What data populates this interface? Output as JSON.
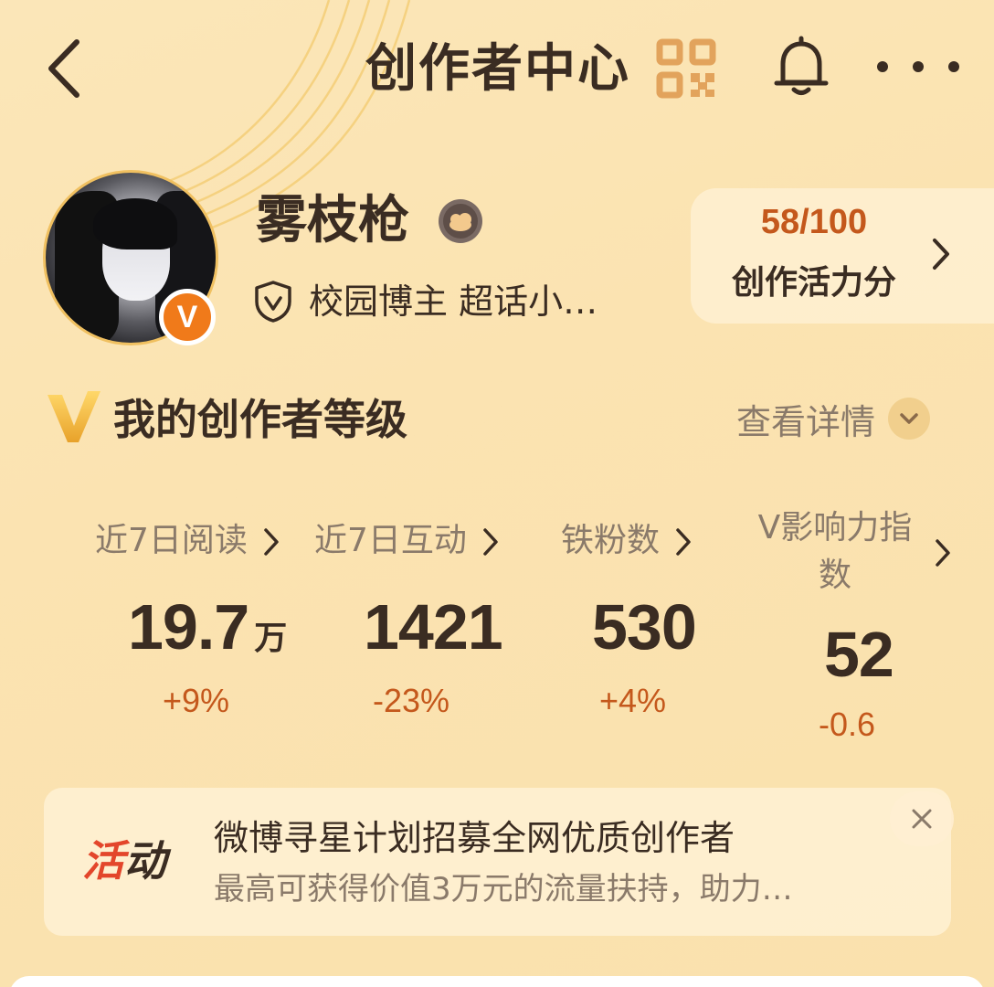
{
  "header": {
    "title": "创作者中心"
  },
  "profile": {
    "username": "雾枝枪",
    "tags": "校园博主 超话小…",
    "verified_badge": "V"
  },
  "score": {
    "value": "58/100",
    "label": "创作活力分"
  },
  "level_section": {
    "title": "我的创作者等级",
    "detail_link": "查看详情"
  },
  "stats": [
    {
      "label": "近7日阅读",
      "value": "19.7",
      "unit": "万",
      "change": "+9%"
    },
    {
      "label": "近7日互动",
      "value": "1421",
      "unit": "",
      "change": "-23%"
    },
    {
      "label": "铁粉数",
      "value": "530",
      "unit": "",
      "change": "+4%"
    },
    {
      "label_line1": "V影响力指",
      "label_line2": "数",
      "value": "52",
      "unit": "",
      "change": "-0.6"
    }
  ],
  "banner": {
    "tag_part1": "活",
    "tag_part2": "动",
    "title": "微博寻星计划招募全网优质创作者",
    "subtitle": "最高可获得价值3万元的流量扶持，助力…"
  },
  "icons": {
    "back": "chevron-left-icon",
    "qr": "qr-code-icon",
    "bell": "bell-icon",
    "more": "more-dots-icon",
    "close": "close-icon"
  },
  "colors": {
    "accent": "#c4581c",
    "badge_orange": "#f07a1a",
    "activity_red": "#e3462b"
  }
}
